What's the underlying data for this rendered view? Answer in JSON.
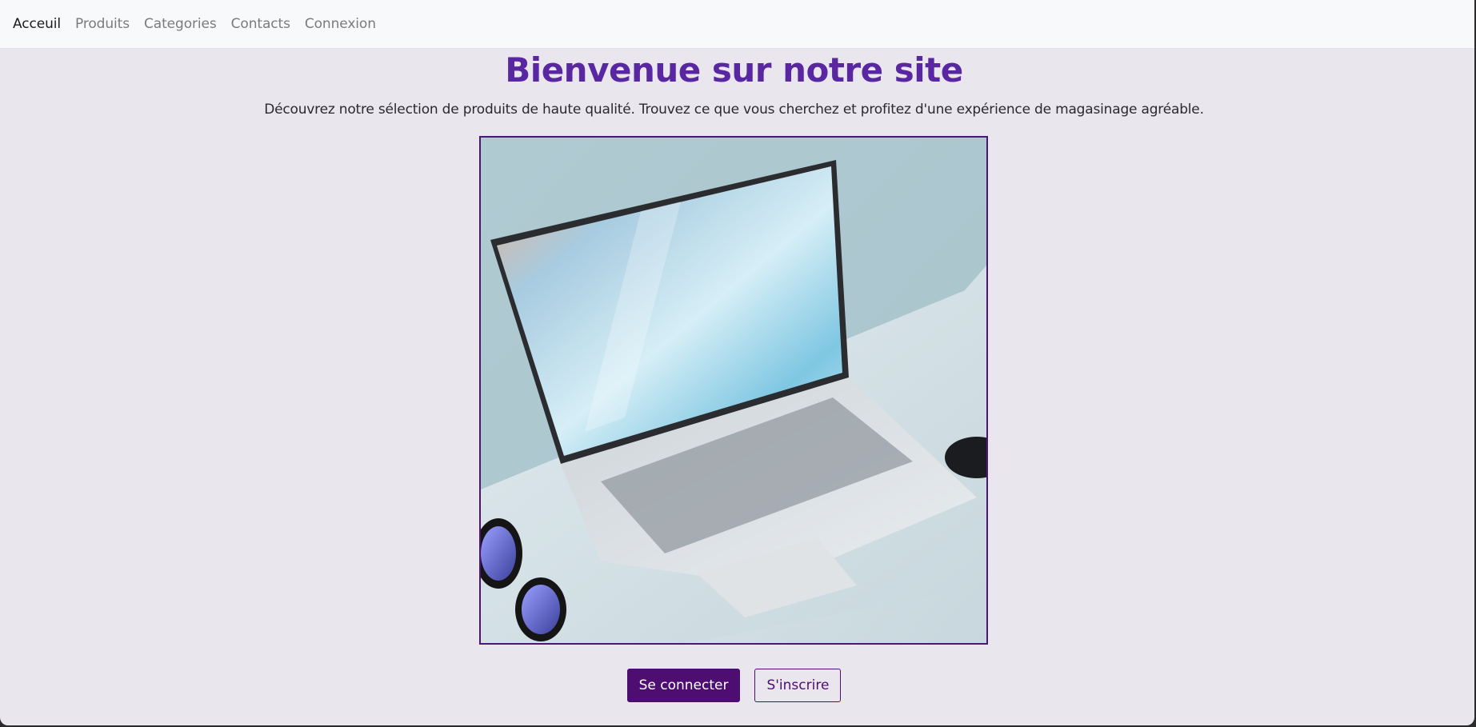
{
  "nav": {
    "items": [
      {
        "label": "Acceuil",
        "active": true
      },
      {
        "label": "Produits",
        "active": false
      },
      {
        "label": "Categories",
        "active": false
      },
      {
        "label": "Contacts",
        "active": false
      },
      {
        "label": "Connexion",
        "active": false
      }
    ]
  },
  "hero": {
    "title": "Bienvenue sur notre site",
    "description": "Découvrez notre sélection de produits de haute qualité. Trouvez ce que vous cherchez et profitez d'une expérience de magasinage agréable.",
    "image_icon": "laptop-photo"
  },
  "actions": {
    "login_label": "Se connecter",
    "signup_label": "S'inscrire"
  },
  "colors": {
    "accent": "#5a27a2",
    "primary_button": "#4e0d70",
    "background": "#e9e6ed",
    "navbar": "#f8f9fb"
  }
}
